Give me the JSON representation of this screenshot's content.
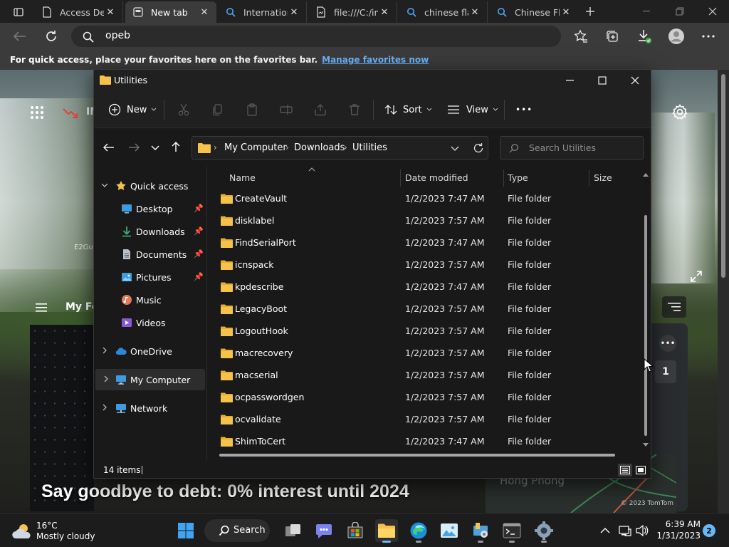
{
  "browser": {
    "tabs": [
      {
        "title": "Access Denied"
      },
      {
        "title": "New tab"
      },
      {
        "title": "International"
      },
      {
        "title": "file:///C:/im"
      },
      {
        "title": "chinese flag"
      },
      {
        "title": "Chinese Flag"
      }
    ],
    "address": "opeb",
    "favbar": {
      "message": "For quick access, place your favorites here on the favorites bar.",
      "link": "Manage favorites now"
    }
  },
  "ntp": {
    "top_label": "IN",
    "tile_label": "E2Gu",
    "my_feed": "My Fe",
    "badge": "1",
    "dots": "•••",
    "headline": "Say goodbye to debt: 0% interest until 2024",
    "map_text": "Hong Phong",
    "map_credit": "© 2023 TomTom"
  },
  "explorer": {
    "title": "Utilities",
    "toolbar": {
      "new": "New",
      "sort": "Sort",
      "view": "View",
      "more": "•••"
    },
    "breadcrumb": [
      "My Computer",
      "Downloads",
      "Utilities"
    ],
    "search_placeholder": "Search Utilities",
    "sidebar": [
      {
        "label": "Quick access",
        "pinned": false
      },
      {
        "label": "Desktop",
        "pinned": true
      },
      {
        "label": "Downloads",
        "pinned": true
      },
      {
        "label": "Documents",
        "pinned": true
      },
      {
        "label": "Pictures",
        "pinned": true
      },
      {
        "label": "Music",
        "pinned": false
      },
      {
        "label": "Videos",
        "pinned": false
      },
      {
        "label": "OneDrive",
        "pinned": false
      },
      {
        "label": "My Computer",
        "pinned": false
      },
      {
        "label": "Network",
        "pinned": false
      }
    ],
    "columns": {
      "name": "Name",
      "date": "Date modified",
      "type": "Type",
      "size": "Size"
    },
    "files": [
      {
        "name": "CreateVault",
        "date": "1/2/2023 7:47 AM",
        "type": "File folder"
      },
      {
        "name": "disklabel",
        "date": "1/2/2023 7:57 AM",
        "type": "File folder"
      },
      {
        "name": "FindSerialPort",
        "date": "1/2/2023 7:47 AM",
        "type": "File folder"
      },
      {
        "name": "icnspack",
        "date": "1/2/2023 7:57 AM",
        "type": "File folder"
      },
      {
        "name": "kpdescribe",
        "date": "1/2/2023 7:47 AM",
        "type": "File folder"
      },
      {
        "name": "LegacyBoot",
        "date": "1/2/2023 7:57 AM",
        "type": "File folder"
      },
      {
        "name": "LogoutHook",
        "date": "1/2/2023 7:57 AM",
        "type": "File folder"
      },
      {
        "name": "macrecovery",
        "date": "1/2/2023 7:57 AM",
        "type": "File folder"
      },
      {
        "name": "macserial",
        "date": "1/2/2023 7:57 AM",
        "type": "File folder"
      },
      {
        "name": "ocpasswordgen",
        "date": "1/2/2023 7:57 AM",
        "type": "File folder"
      },
      {
        "name": "ocvalidate",
        "date": "1/2/2023 7:57 AM",
        "type": "File folder"
      },
      {
        "name": "ShimToCert",
        "date": "1/2/2023 7:47 AM",
        "type": "File folder"
      }
    ],
    "status": "14 items"
  },
  "taskbar": {
    "weather_temp": "16°C",
    "weather_cond": "Mostly cloudy",
    "search_label": "Search",
    "time": "6:39 AM",
    "date": "1/31/2023",
    "notifications": "2"
  },
  "colors": {
    "accent": "#67b8f7",
    "folder": "#f5c24b",
    "link": "#6cb6ff"
  }
}
